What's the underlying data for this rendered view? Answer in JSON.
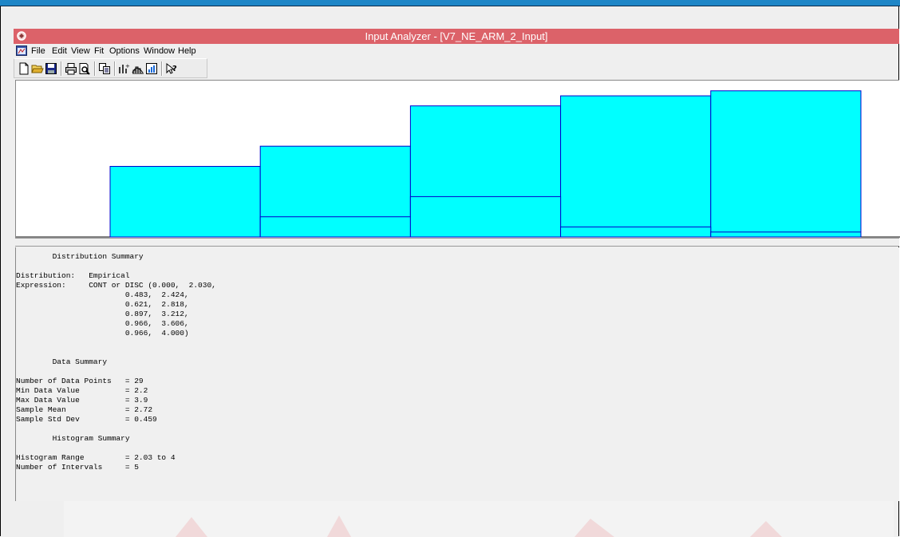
{
  "window": {
    "title": "Input Analyzer - [V7_NE_ARM_2_Input]",
    "title_bar_color": "#dc6269"
  },
  "menu": {
    "items": [
      "File",
      "Edit",
      "View",
      "Fit",
      "Options",
      "Window",
      "Help"
    ]
  },
  "toolbar": {
    "buttons": [
      "new-icon",
      "open-icon",
      "save-icon",
      "print-icon",
      "print-preview-icon",
      "copy-icon",
      "data-icon",
      "fit-icon",
      "histogram-icon",
      "help-pointer-icon"
    ]
  },
  "chart_data": {
    "type": "bar",
    "categories": [
      "2.030-2.424",
      "2.424-2.818",
      "2.818-3.212",
      "3.212-3.606",
      "3.606-4.000"
    ],
    "series": [
      {
        "values": [
          0.483,
          0.621,
          0.897,
          0.966,
          1.0
        ]
      },
      {
        "values": [
          0.0,
          0.138,
          0.276,
          0.069,
          0.034
        ]
      }
    ],
    "bar_color": "#00ffff",
    "edge_color": "#0000cc",
    "xlim": [
      2.03,
      4.0
    ],
    "ylim": [
      0,
      1.07
    ],
    "grid": false
  },
  "summary": {
    "lines": [
      "        Distribution Summary",
      "",
      "Distribution:   Empirical",
      "Expression:     CONT or DISC (0.000,  2.030,",
      "                        0.483,  2.424,",
      "                        0.621,  2.818,",
      "                        0.897,  3.212,",
      "                        0.966,  3.606,",
      "                        0.966,  4.000)",
      "",
      "",
      "        Data Summary",
      "",
      "Number of Data Points   = 29",
      "Min Data Value          = 2.2",
      "Max Data Value          = 3.9",
      "Sample Mean             = 2.72",
      "Sample Std Dev          = 0.459",
      "",
      "        Histogram Summary",
      "",
      "Histogram Range         = 2.03 to 4",
      "Number of Intervals     = 5"
    ]
  }
}
